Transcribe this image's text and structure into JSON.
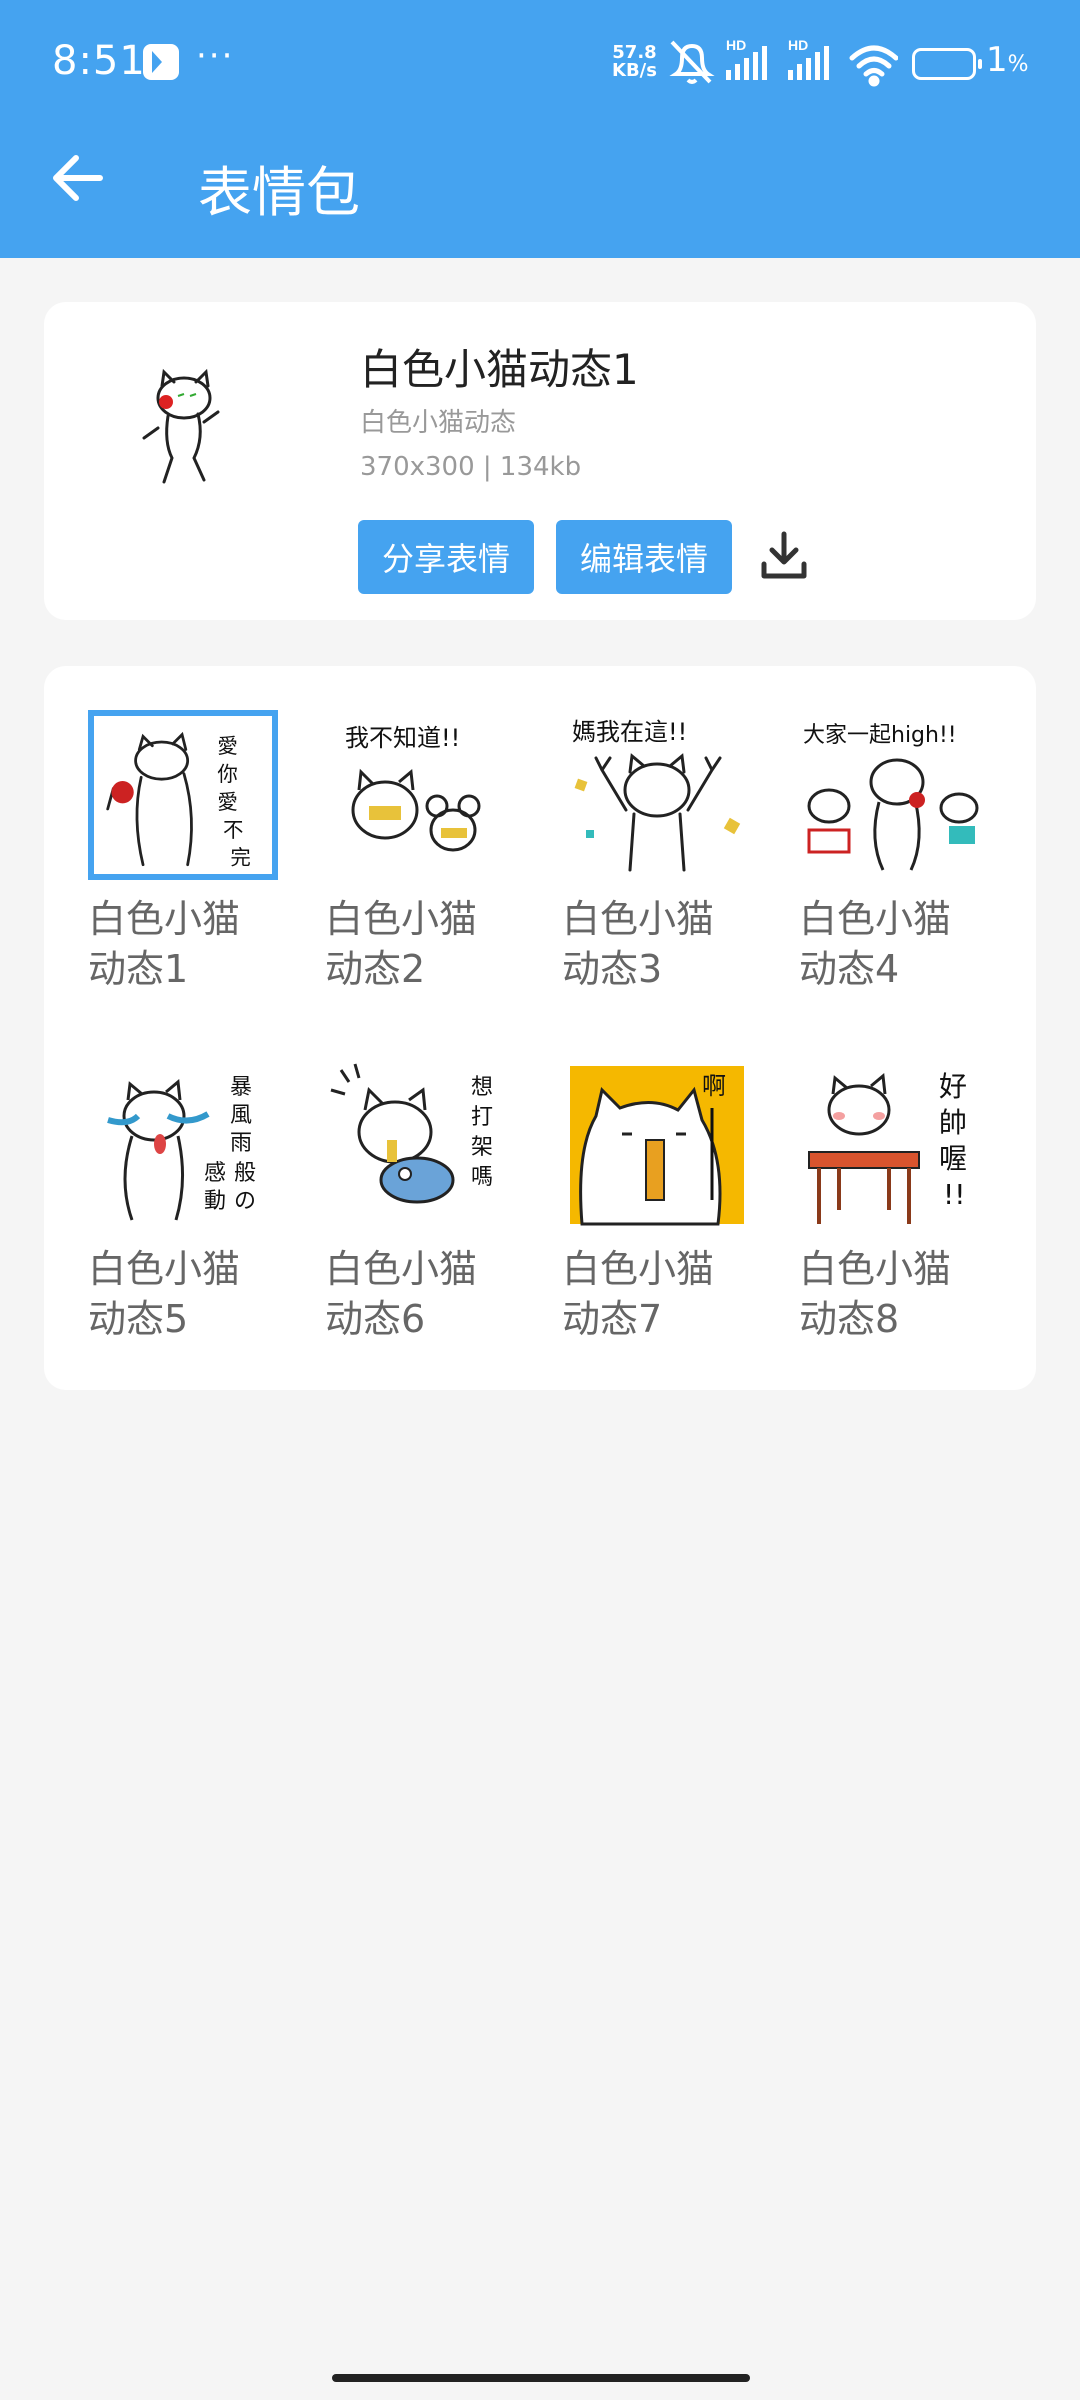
{
  "status_bar": {
    "time": "8:51",
    "net_speed_value": "57.8",
    "net_speed_unit": "KB/s",
    "battery_percent": "1",
    "battery_unit": "%"
  },
  "header": {
    "title": "表情包",
    "back_icon": "arrow-left-icon"
  },
  "detail": {
    "name": "白色小猫动态1",
    "pack": "白色小猫动态",
    "meta": "370x300 | 134kb",
    "share_label": "分享表情",
    "edit_label": "编辑表情",
    "download_icon": "download-icon"
  },
  "stickers": [
    {
      "label": "白色小猫动态1",
      "caption": "愛你愛不完",
      "selected": true
    },
    {
      "label": "白色小猫动态2",
      "caption": "我不知道!!"
    },
    {
      "label": "白色小猫动态3",
      "caption": "媽我在這!!"
    },
    {
      "label": "白色小猫动态4",
      "caption": "大家一起high!!"
    },
    {
      "label": "白色小猫动态5",
      "caption": "暴風雨般の感動!!"
    },
    {
      "label": "白色小猫动态6",
      "caption": "想打架嗎"
    },
    {
      "label": "白色小猫动态7",
      "caption": "啊!!"
    },
    {
      "label": "白色小猫动态8",
      "caption": "好帥喔!!"
    }
  ],
  "colors": {
    "accent": "#45a3f0",
    "background": "#f5f5f5",
    "card": "#ffffff"
  }
}
